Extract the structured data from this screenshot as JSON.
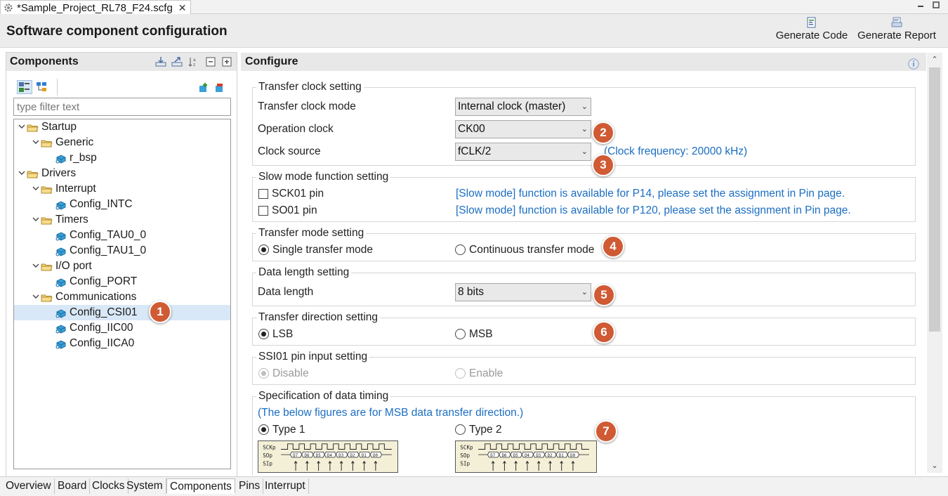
{
  "editor_tab": {
    "title": "*Sample_Project_RL78_F24.scfg",
    "close": "✕"
  },
  "header": {
    "title": "Software component configuration",
    "generate_code": "Generate Code",
    "generate_report": "Generate Report"
  },
  "components": {
    "title": "Components",
    "filter_placeholder": "type filter text",
    "tree": [
      {
        "label": "Startup",
        "chevron": "v"
      },
      {
        "label": "Generic",
        "chevron": "v"
      },
      {
        "label": "r_bsp"
      },
      {
        "label": "Drivers",
        "chevron": "v"
      },
      {
        "label": "Interrupt",
        "chevron": "v"
      },
      {
        "label": "Config_INTC"
      },
      {
        "label": "Timers",
        "chevron": "v"
      },
      {
        "label": "Config_TAU0_0"
      },
      {
        "label": "Config_TAU1_0"
      },
      {
        "label": "I/O port",
        "chevron": "v"
      },
      {
        "label": "Config_PORT"
      },
      {
        "label": "Communications",
        "chevron": "v"
      },
      {
        "label": "Config_CSI01",
        "selected": true
      },
      {
        "label": "Config_IIC00"
      },
      {
        "label": "Config_IICA0"
      }
    ]
  },
  "configure": {
    "title": "Configure",
    "info_icon": "ⓘ",
    "transfer_clock": {
      "legend": "Transfer clock setting",
      "mode_label": "Transfer clock mode",
      "mode_value": "Internal clock (master)",
      "op_clock_label": "Operation clock",
      "op_clock_value": "CK00",
      "source_label": "Clock source",
      "source_value": "fCLK/2",
      "frequency_note": "(Clock frequency: 20000 kHz)"
    },
    "slow_mode": {
      "legend": "Slow mode function setting",
      "sck_label": "SCK01 pin",
      "sck_note": "[Slow mode] function is available for P14, please set the assignment in Pin page.",
      "so_label": "SO01 pin",
      "so_note": "[Slow mode] function is available for P120, please set the assignment in Pin page."
    },
    "transfer_mode": {
      "legend": "Transfer mode setting",
      "single": "Single transfer mode",
      "continuous": "Continuous transfer mode"
    },
    "data_length": {
      "legend": "Data length setting",
      "label": "Data length",
      "value": "8 bits"
    },
    "direction": {
      "legend": "Transfer direction setting",
      "lsb": "LSB",
      "msb": "MSB"
    },
    "ssi": {
      "legend": "SSI01 pin input setting",
      "disable": "Disable",
      "enable": "Enable"
    },
    "timing": {
      "legend": "Specification of data timing",
      "note": "(The below figures are for MSB data transfer direction.)",
      "type1": "Type 1",
      "type2": "Type 2",
      "signal_labels": [
        "SCKp",
        "SOp",
        "SIp"
      ],
      "bits": [
        "D7",
        "D6",
        "D5",
        "D4",
        "D3",
        "D2",
        "D1",
        "D0"
      ]
    }
  },
  "callouts": [
    "1",
    "2",
    "3",
    "4",
    "5",
    "6",
    "7"
  ],
  "bottom_tabs": [
    "Overview",
    "Board",
    "Clocks",
    "System",
    "Components",
    "Pins",
    "Interrupt"
  ],
  "active_bottom_tab": "Components",
  "colors": {
    "callout": "#d05a34",
    "link_blue": "#1b6ec2",
    "selection": "#d9e8f7"
  }
}
